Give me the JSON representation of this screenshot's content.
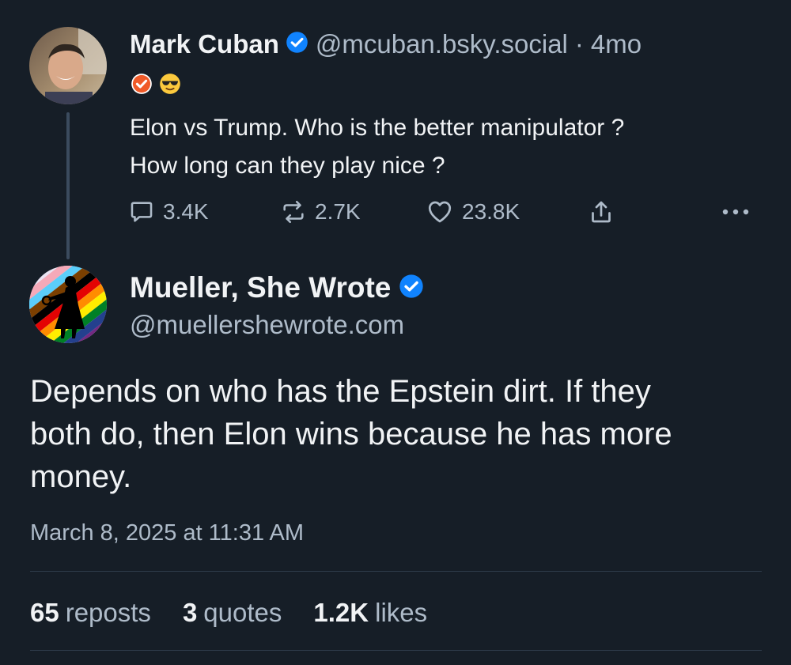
{
  "parent_post": {
    "author_name": "Mark Cuban",
    "handle": "@mcuban.bsky.social",
    "separator": "·",
    "age": "4mo",
    "badges": [
      "checkmark-badge",
      "sunglasses-emoji"
    ],
    "text_lines": [
      "Elon vs Trump.  Who is the better manipulator ?",
      "How long can they play nice ?"
    ],
    "replies": "3.4K",
    "reposts": "2.7K",
    "likes": "23.8K",
    "verified": true
  },
  "reply_post": {
    "author_name": "Mueller, She Wrote",
    "handle": "@muellershewrote.com",
    "verified": true,
    "text_lines": [
      "Depends on who has the Epstein dirt. If they",
      "both do, then Elon wins because he has more",
      "money."
    ],
    "timestamp": "March 8, 2025 at 11:31 AM",
    "stats": {
      "reposts_count": "65",
      "reposts_label": "reposts",
      "quotes_count": "3",
      "quotes_label": "quotes",
      "likes_count": "1.2K",
      "likes_label": "likes"
    }
  },
  "colors": {
    "background": "#161e27",
    "text_primary": "#f1f3f5",
    "text_secondary": "#aebbc9",
    "verified_blue": "#1083fe",
    "badge_orange": "#f05a28",
    "thread_line": "#3b4b5e"
  }
}
